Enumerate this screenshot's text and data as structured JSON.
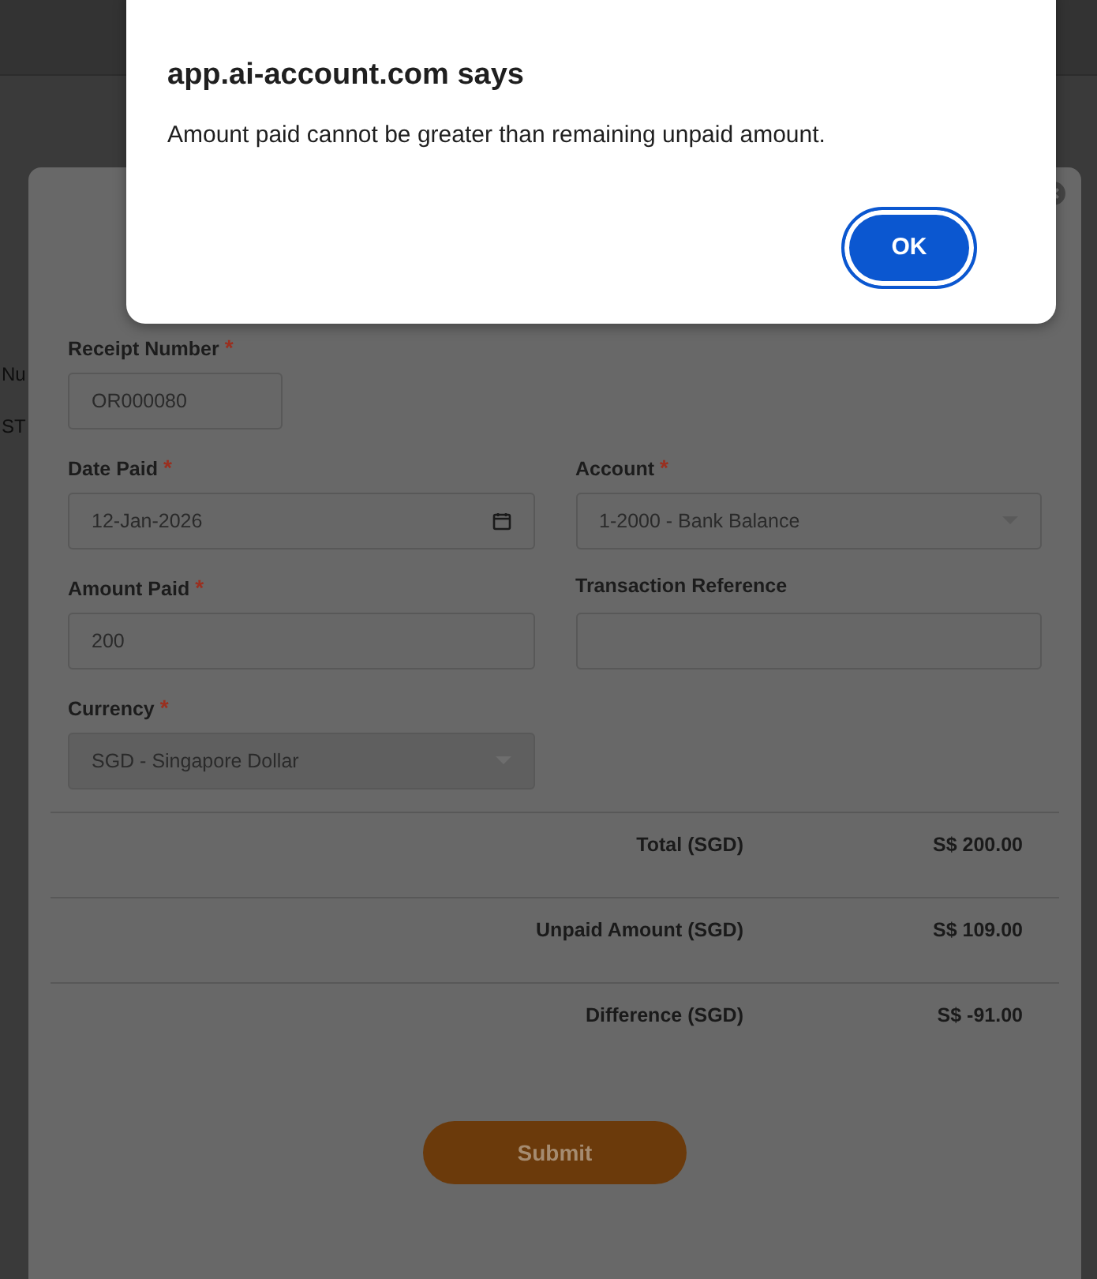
{
  "background_page": {
    "left_fragments": [
      "Nu",
      "ST"
    ]
  },
  "modal": {
    "rows": [
      [
        {
          "kind": "text",
          "label": "Receipt Number",
          "required_mark": "*",
          "value": "OR000080"
        }
      ],
      [
        {
          "kind": "date",
          "label": "Date Paid",
          "required_mark": "*",
          "value": "12-Jan-2026"
        },
        {
          "kind": "select",
          "label": "Account",
          "required_mark": "*",
          "value": "1-2000 - Bank Balance"
        }
      ],
      [
        {
          "kind": "text",
          "label": "Amount Paid",
          "required_mark": "*",
          "value": "200"
        },
        {
          "kind": "text",
          "label": "Transaction Reference"
        }
      ],
      [
        {
          "kind": "select",
          "label": "Currency",
          "required_mark": "*",
          "value": "SGD - Singapore Dollar",
          "disabled": true
        }
      ]
    ],
    "summary": [
      {
        "label": "Total (SGD)",
        "value": "S$ 200.00"
      },
      {
        "label": "Unpaid Amount (SGD)",
        "value": "S$ 109.00"
      },
      {
        "label": "Difference (SGD)",
        "value": "S$ -91.00"
      }
    ],
    "submit_label": "Submit"
  },
  "alert": {
    "title": "app.ai-account.com says",
    "message": "Amount paid cannot be greater than remaining unpaid amount.",
    "button": "OK"
  }
}
